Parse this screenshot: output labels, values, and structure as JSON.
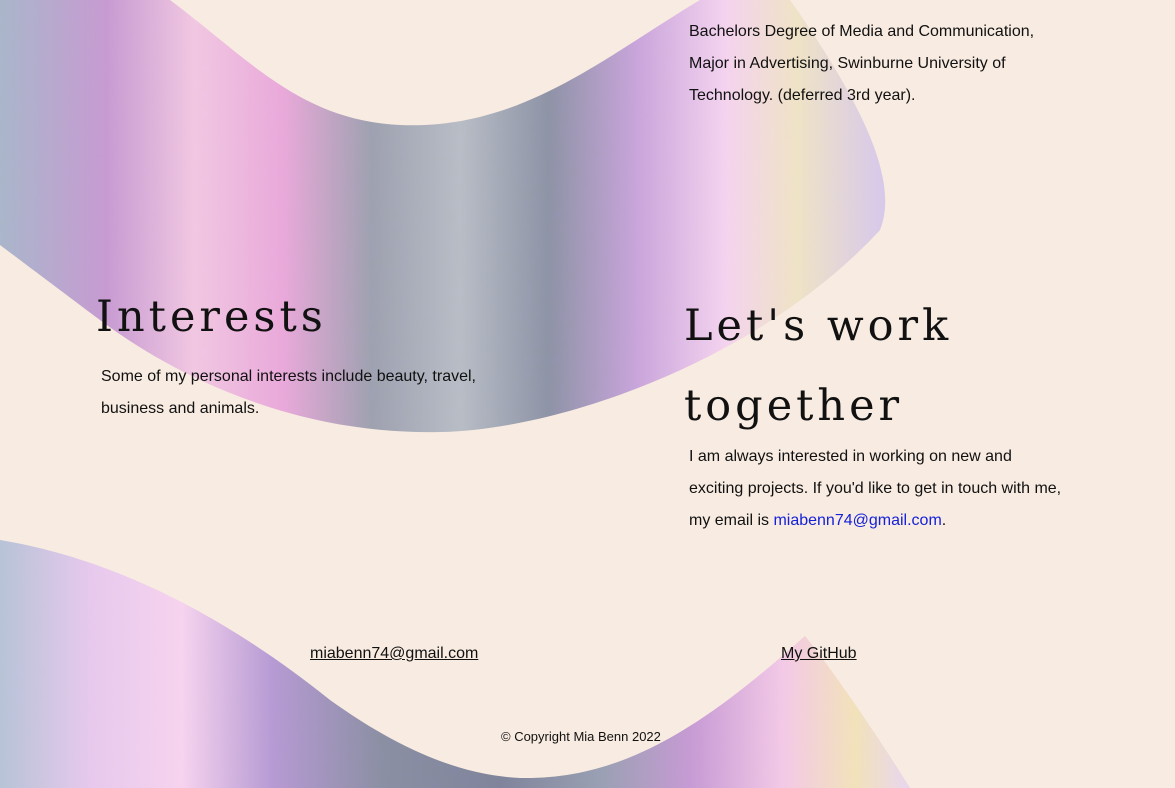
{
  "education": {
    "text": "Bachelors Degree of Media and Communication, Major in Advertising, Swinburne University of Technology. (deferred 3rd year)."
  },
  "interests": {
    "heading": "Interests",
    "text": "Some of my personal interests include beauty, travel, business and animals."
  },
  "work": {
    "heading": "Let's work together",
    "text_before": "I am always interested in working on new and exciting projects. If you'd like to get in touch with me, my email is ",
    "email_link": "miabenn74@gmail.com",
    "text_after": "."
  },
  "footer": {
    "email_link": "miabenn74@gmail.com",
    "github_link": "My GitHub",
    "copyright": "© Copyright Mia Benn 2022"
  },
  "colors": {
    "background": "#f8ebe1",
    "link": "#1521d8",
    "text": "#111111"
  },
  "decorations": {
    "top_wave": "holographic-foil-wave",
    "bottom_wave": "holographic-foil-wave"
  }
}
